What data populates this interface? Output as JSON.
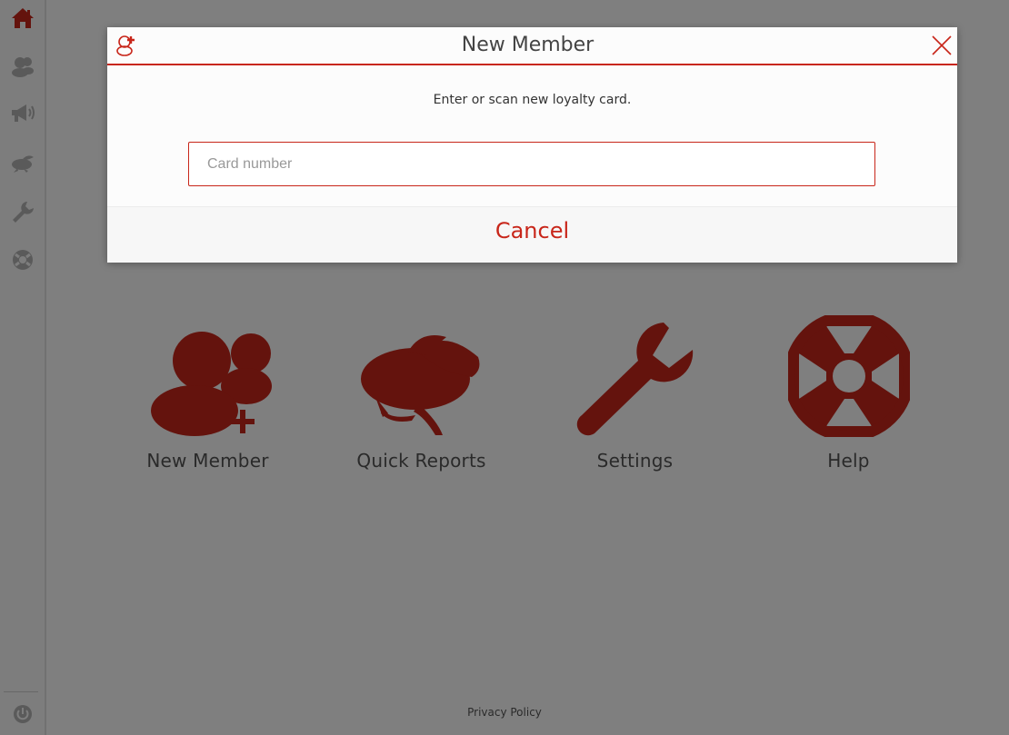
{
  "colors": {
    "accent": "#c8261a",
    "tile_icon": "#c8261a",
    "sidebar_icon": "#8a8a8a"
  },
  "sidebar": {
    "items": [
      {
        "icon": "home-icon"
      },
      {
        "icon": "members-icon"
      },
      {
        "icon": "megaphone-icon"
      },
      {
        "icon": "rabbit-icon"
      },
      {
        "icon": "wrench-icon"
      },
      {
        "icon": "lifebuoy-icon"
      }
    ],
    "bottom": {
      "icon": "power-icon"
    }
  },
  "tiles": [
    {
      "label": "New Member",
      "icon": "add-member-icon"
    },
    {
      "label": "Quick Reports",
      "icon": "rabbit-icon"
    },
    {
      "label": "Settings",
      "icon": "wrench-icon"
    },
    {
      "label": "Help",
      "icon": "lifebuoy-icon"
    }
  ],
  "footer": {
    "privacy": "Privacy Policy"
  },
  "dialog": {
    "title": "New Member",
    "message": "Enter or scan new loyalty card.",
    "input_placeholder": "Card number",
    "input_value": "",
    "cancel_label": "Cancel"
  }
}
